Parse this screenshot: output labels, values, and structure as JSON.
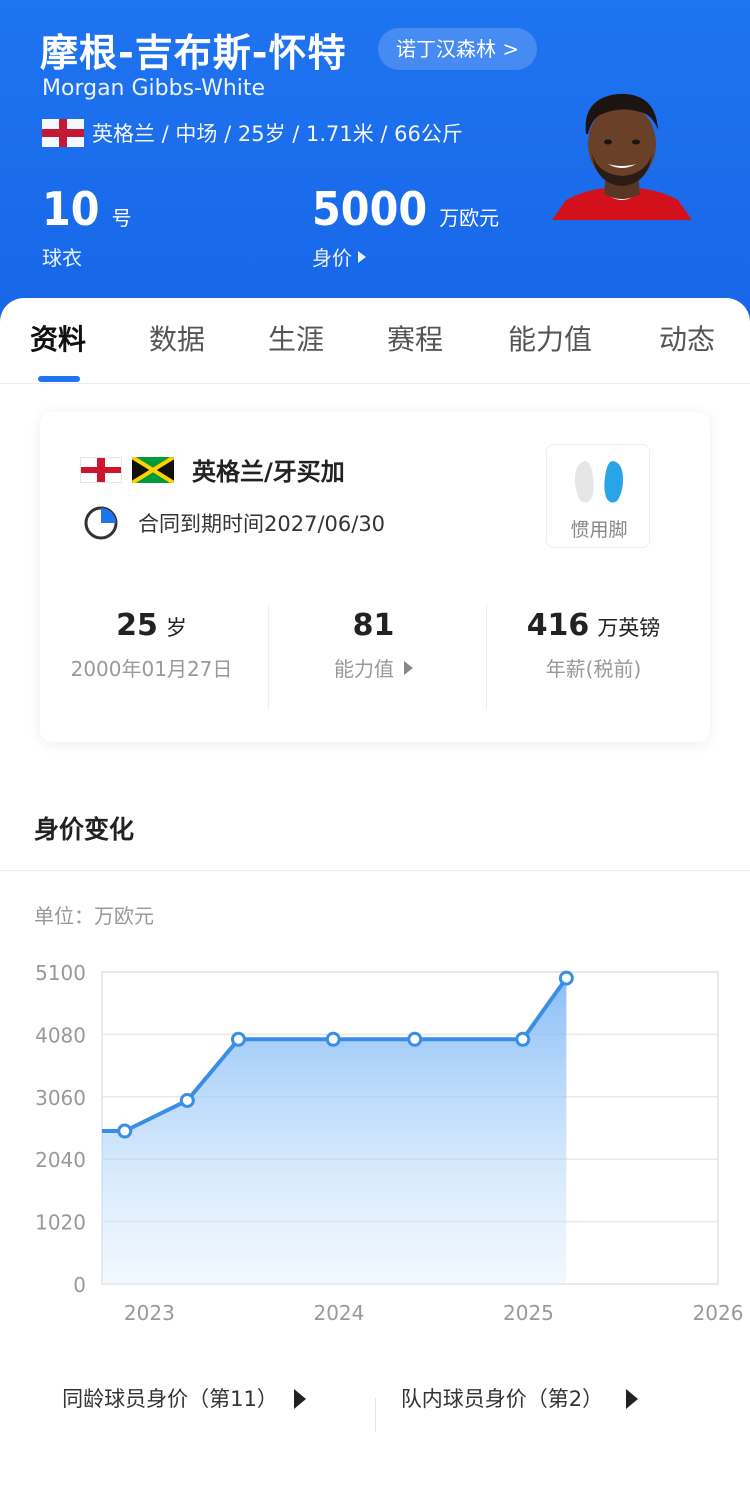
{
  "header": {
    "name_cn": "摩根-吉布斯-怀特",
    "club": "诺丁汉森林 >",
    "name_en": "Morgan Gibbs-White",
    "info": "英格兰 / 中场 / 25岁 / 1.71米 / 66公斤",
    "shirt_number": "10",
    "shirt_unit": "号",
    "shirt_label": "球衣",
    "value": "5000",
    "value_unit": "万欧元",
    "value_label": "身价"
  },
  "tabs": [
    {
      "label": "资料",
      "active": true
    },
    {
      "label": "数据"
    },
    {
      "label": "生涯"
    },
    {
      "label": "赛程"
    },
    {
      "label": "能力值"
    },
    {
      "label": "动态"
    }
  ],
  "card": {
    "nationality": "英格兰/牙买加",
    "contract": "合同到期时间2027/06/30",
    "foot_label": "惯用脚",
    "age_value": "25",
    "age_unit": "岁",
    "birth": "2000年01月27日",
    "rating_value": "81",
    "rating_label": "能力值",
    "salary_value": "416",
    "salary_unit": "万英镑",
    "salary_label": "年薪(税前)"
  },
  "section": {
    "title": "身价变化",
    "unit": "单位：万欧元"
  },
  "chart_data": {
    "type": "area",
    "y_ticks": [
      "5100",
      "4080",
      "3060",
      "2040",
      "1020",
      "0"
    ],
    "x_ticks": [
      "2023",
      "2024",
      "2025",
      "2026"
    ],
    "ylim": [
      0,
      5100
    ],
    "xlim": [
      2022.75,
      2026.0
    ],
    "points": [
      {
        "x": 2022.75,
        "y": 2500
      },
      {
        "x": 2022.87,
        "y": 2500
      },
      {
        "x": 2023.2,
        "y": 3000
      },
      {
        "x": 2023.47,
        "y": 4000
      },
      {
        "x": 2023.97,
        "y": 4000
      },
      {
        "x": 2024.4,
        "y": 4000
      },
      {
        "x": 2024.97,
        "y": 4000
      },
      {
        "x": 2025.2,
        "y": 5000
      }
    ],
    "line_color": "#3a8ee6"
  },
  "ranks": [
    {
      "label": "同龄球员身价（第11）"
    },
    {
      "label": "队内球员身价（第2）"
    }
  ],
  "colors": {
    "primary": "#1f74f0",
    "england_red": "#cf142b",
    "jamaica_green": "#009b3a",
    "jamaica_gold": "#fed100"
  }
}
